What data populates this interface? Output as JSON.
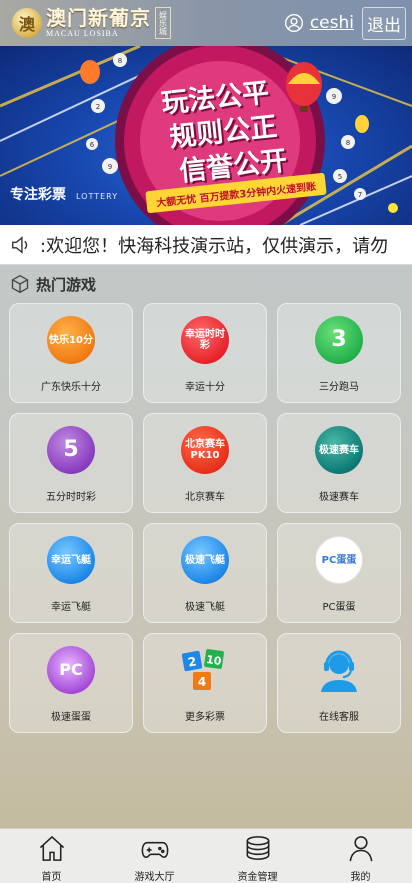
{
  "header": {
    "logo_emblem": "澳",
    "logo_main": "澳门新葡京",
    "logo_sub": "MACAU LOSIBA",
    "logo_badge": "娱乐城",
    "username": "ceshi",
    "logout_label": "退出",
    "user_icon": "user-icon"
  },
  "banner": {
    "line1": "玩法公平",
    "line2": "规则公正",
    "line3": "信誉公开",
    "slogan": "大额无忧 百万提款3分钟内火速到账",
    "left_cn": "专注彩票",
    "left_en": "LOTTERY"
  },
  "marquee": {
    "icon": "speaker-icon",
    "text": ":欢迎您！快海科技演示站，仅供演示，请勿"
  },
  "section": {
    "icon": "cube-icon",
    "title": "热门游戏"
  },
  "games": [
    {
      "label": "广东快乐十分",
      "icon_text": "快乐10分",
      "style": "ic-orange"
    },
    {
      "label": "幸运十分",
      "icon_text": "幸运时时彩",
      "style": "ic-red"
    },
    {
      "label": "三分跑马",
      "icon_text": "3",
      "style": "ic-green"
    },
    {
      "label": "五分时时彩",
      "icon_text": "5",
      "style": "ic-purple"
    },
    {
      "label": "北京赛车",
      "icon_text": "北京赛车 PK10",
      "style": "ic-redcar"
    },
    {
      "label": "极速赛车",
      "icon_text": "极速赛车",
      "style": "ic-teal"
    },
    {
      "label": "幸运飞艇",
      "icon_text": "幸运飞艇",
      "style": "ic-blue"
    },
    {
      "label": "极速飞艇",
      "icon_text": "极速飞艇",
      "style": "ic-blue"
    },
    {
      "label": "PC蛋蛋",
      "icon_text": "PC蛋蛋",
      "style": "ic-white"
    },
    {
      "label": "极速蛋蛋",
      "icon_text": "PC",
      "style": "ic-egg"
    },
    {
      "label": "更多彩票",
      "icon_text": "",
      "style": "ic-tiles"
    },
    {
      "label": "在线客服",
      "icon_text": "",
      "style": "ic-cs"
    }
  ],
  "nav": [
    {
      "label": "首页",
      "icon": "home-icon"
    },
    {
      "label": "游戏大厅",
      "icon": "gamepad-icon"
    },
    {
      "label": "资金管理",
      "icon": "coins-icon"
    },
    {
      "label": "我的",
      "icon": "person-icon"
    }
  ],
  "colors": {
    "banner_blue": "#1848b0",
    "slogan_yellow": "#ffd633",
    "accent_red": "#e8232b"
  }
}
